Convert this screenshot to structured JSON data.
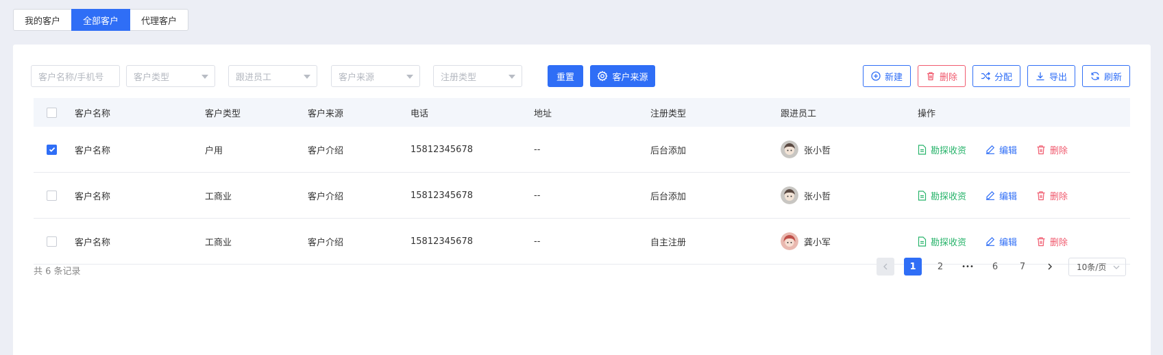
{
  "tabs": [
    "我的客户",
    "全部客户",
    "代理客户"
  ],
  "filters": {
    "name_placeholder": "客户名称/手机号",
    "type_placeholder": "客户类型",
    "staff_placeholder": "跟进员工",
    "source_placeholder": "客户来源",
    "reg_placeholder": "注册类型"
  },
  "toolbar": {
    "reset_label": "重置",
    "source_label": "客户来源",
    "new_label": "新建",
    "delete_label": "删除",
    "assign_label": "分配",
    "export_label": "导出",
    "refresh_label": "刷新"
  },
  "table": {
    "headers": [
      "客户名称",
      "客户类型",
      "客户来源",
      "电话",
      "地址",
      "注册类型",
      "跟进员工",
      "操作"
    ],
    "rows": [
      {
        "checked": true,
        "name": "客户名称",
        "type": "户用",
        "source": "客户介绍",
        "phone": "15812345678",
        "address": "--",
        "reg": "后台添加",
        "staff": "张小哲",
        "op1": "勘探收资",
        "op2": "编辑",
        "op3": "删除"
      },
      {
        "checked": false,
        "name": "客户名称",
        "type": "工商业",
        "source": "客户介绍",
        "phone": "15812345678",
        "address": "--",
        "reg": "后台添加",
        "staff": "张小哲",
        "op1": "勘探收资",
        "op2": "编辑",
        "op3": "删除"
      },
      {
        "checked": false,
        "name": "客户名称",
        "type": "工商业",
        "source": "客户介绍",
        "phone": "15812345678",
        "address": "--",
        "reg": "自主注册",
        "staff": "龚小军",
        "op1": "勘探收资",
        "op2": "编辑",
        "op3": "删除"
      }
    ]
  },
  "pagination": {
    "total_text": "共 6 条记录",
    "pages": [
      "1",
      "2",
      "•••",
      "6",
      "7"
    ],
    "page_size": "10条/页"
  },
  "colors": {
    "primary": "#2f6ef6",
    "success": "#27b36a",
    "danger": "#f05a6e"
  }
}
